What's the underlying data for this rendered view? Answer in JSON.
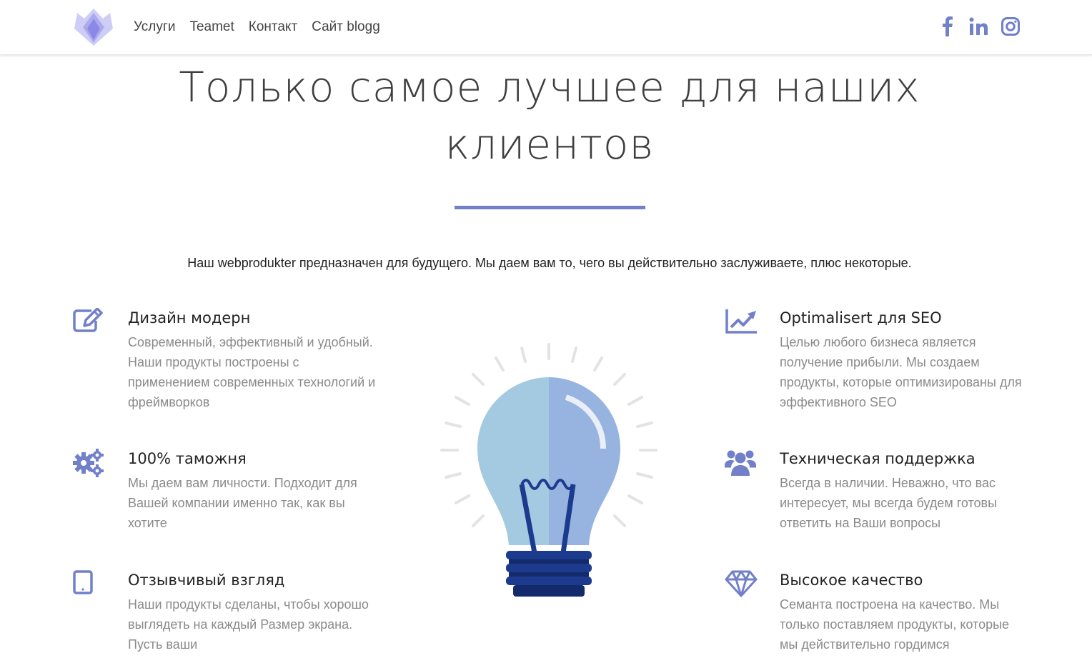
{
  "nav": {
    "links": [
      "Услуги",
      "Teamet",
      "Контакт",
      "Сайт blogg"
    ],
    "social": [
      "facebook-icon",
      "linkedin-icon",
      "instagram-icon"
    ]
  },
  "hero": {
    "title_line1": "Только самое лучшее для наших",
    "title_line2": "клиентов",
    "tagline": "Наш webprodukter предназначен для будущего. Мы даем вам то, чего вы действительно заслуживаете, плюс некоторые."
  },
  "colors": {
    "accent": "#7180c9",
    "title": "#3e3e3e",
    "body_text": "#8a8a8a",
    "bulb_left": "#a3cae0",
    "bulb_right": "#97b3df",
    "bulb_base": "#1c3b8f"
  },
  "features": {
    "left": [
      {
        "icon": "edit-icon",
        "title": "Дизайн модерн",
        "text": "Современный, эффективный и удобный. Наши продукты построены с применением современных технологий и фреймворков"
      },
      {
        "icon": "gears-icon",
        "title": "100% таможня",
        "text": "Мы даем вам личности. Подходит для Вашей компании именно так, как вы хотите"
      },
      {
        "icon": "tablet-icon",
        "title": "Отзывчивый взгляд",
        "text": "Наши продукты сделаны, чтобы хорошо выглядеть на каждый Размер экрана. Пусть ваши"
      }
    ],
    "right": [
      {
        "icon": "line-chart-icon",
        "title": "Optimalisert для SEO",
        "text": "Целью любого бизнеса является получение прибыли. Мы создаем продукты, которые оптимизированы для эффективного SEO"
      },
      {
        "icon": "users-icon",
        "title": "Техническая поддержка",
        "text": "Всегда в наличии. Неважно, что вас интересует, мы всегда будем готовы ответить на Ваши вопросы"
      },
      {
        "icon": "diamond-icon",
        "title": "Высокое качество",
        "text": "Семанта построена на качество. Мы только поставляем продукты, которые мы действительно гордимся"
      }
    ]
  }
}
